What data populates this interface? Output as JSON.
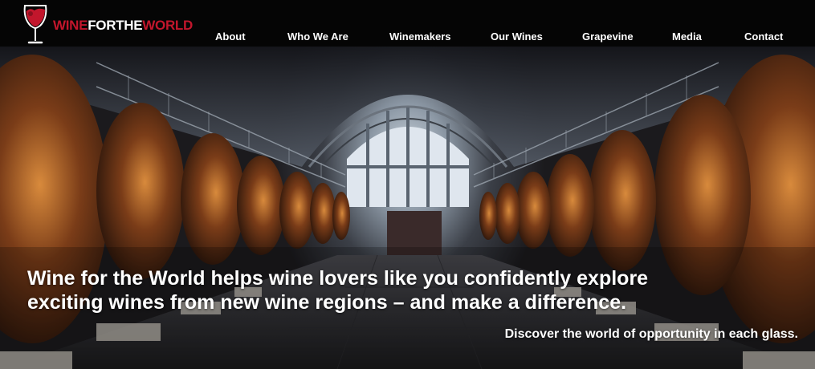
{
  "header": {
    "logo": {
      "part1": "WINE",
      "part2": "FORTHE",
      "part3": "WORLD",
      "brand_red": "#c2162c"
    },
    "nav": [
      {
        "label": "About"
      },
      {
        "label": "Who We Are"
      },
      {
        "label": "Winemakers"
      },
      {
        "label": "Our Wines"
      },
      {
        "label": "Grapevine"
      },
      {
        "label": "Media"
      },
      {
        "label": "Contact"
      }
    ]
  },
  "hero": {
    "headline_line1": "Wine for the World helps wine lovers like you confidently explore",
    "headline_line2": "exciting wines from new wine regions – and make a difference.",
    "subheadline": "Discover the world of opportunity in each glass."
  }
}
